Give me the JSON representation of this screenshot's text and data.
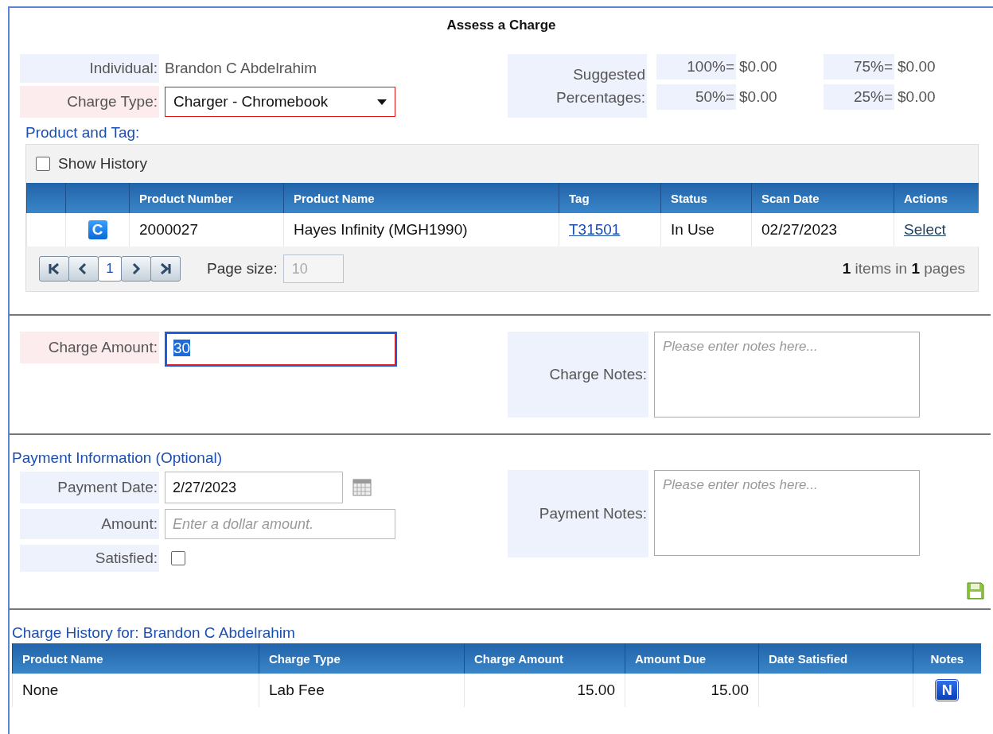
{
  "title": "Assess a Charge",
  "individual": {
    "label": "Individual:",
    "value": "Brandon C Abdelrahim",
    "required": false
  },
  "charge_type": {
    "label": "Charge Type:",
    "value": "Charger - Chromebook",
    "required": true
  },
  "suggested": {
    "label": "Suggested Percentages:",
    "items": [
      {
        "label": "100%=",
        "value": "$0.00"
      },
      {
        "label": "75%=",
        "value": "$0.00"
      },
      {
        "label": "50%=",
        "value": "$0.00"
      },
      {
        "label": "25%=",
        "value": "$0.00"
      }
    ]
  },
  "product_section": {
    "title": "Product and Tag:",
    "show_history": {
      "label": "Show History",
      "checked": false
    },
    "columns": [
      "Product Number",
      "Product Name",
      "Tag",
      "Status",
      "Scan Date",
      "Actions"
    ],
    "rows": [
      {
        "badge": "C",
        "product_number": "2000027",
        "product_name": "Hayes Infinity (MGH1990)",
        "tag": "T31501",
        "status": "In Use",
        "scan_date": "02/27/2023",
        "action": "Select"
      }
    ],
    "pager": {
      "page": "1",
      "page_size_label": "Page size:",
      "page_size": "10",
      "summary": "**1** items in **1** pages"
    }
  },
  "charge_amount": {
    "label": "Charge Amount:",
    "value": "30",
    "required": true
  },
  "charge_notes": {
    "label": "Charge Notes:",
    "placeholder": "Please enter notes here..."
  },
  "payment": {
    "title": "Payment Information (Optional)",
    "date": {
      "label": "Payment Date:",
      "value": "2/27/2023"
    },
    "amount": {
      "label": "Amount:",
      "placeholder": "Enter a dollar amount."
    },
    "satisfied": {
      "label": "Satisfied:",
      "checked": false
    },
    "notes": {
      "label": "Payment Notes:",
      "placeholder": "Please enter notes here..."
    }
  },
  "history": {
    "title": "Charge History for: Brandon C Abdelrahim",
    "columns": [
      "Product Name",
      "Charge Type",
      "Charge Amount",
      "Amount Due",
      "Date Satisfied",
      "Notes"
    ],
    "rows": [
      {
        "product_name": "None",
        "charge_type": "Lab Fee",
        "charge_amount": "15.00",
        "amount_due": "15.00",
        "notes": "N"
      }
    ]
  }
}
